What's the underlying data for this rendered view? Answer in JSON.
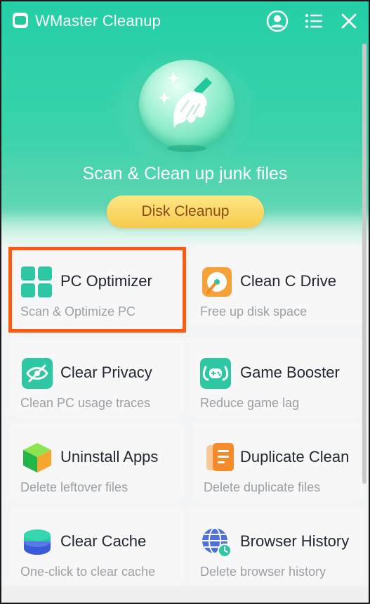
{
  "app": {
    "title": "WMaster Cleanup"
  },
  "titlebar": {
    "icons": [
      "user-icon",
      "menu-icon",
      "close-icon"
    ]
  },
  "hero": {
    "subtitle": "Scan & Clean up junk files",
    "cta_label": "Disk Cleanup",
    "illustration": "broom-icon"
  },
  "features": [
    {
      "title": "PC Optimizer",
      "subtitle": "Scan & Optimize PC",
      "icon": "windows-grid-icon",
      "highlighted": true
    },
    {
      "title": "Clean C Drive",
      "subtitle": "Free up disk space",
      "icon": "disk-icon"
    },
    {
      "title": "Clear Privacy",
      "subtitle": "Clean PC usage traces",
      "icon": "privacy-eye-icon"
    },
    {
      "title": "Game Booster",
      "subtitle": "Reduce game lag",
      "icon": "gamepad-icon"
    },
    {
      "title": "Uninstall Apps",
      "subtitle": "Delete leftover files",
      "icon": "package-cube-icon"
    },
    {
      "title": "Duplicate Clean",
      "subtitle": "Delete duplicate files",
      "icon": "documents-icon"
    },
    {
      "title": "Clear Cache",
      "subtitle": "One-click to clear cache",
      "icon": "database-icon"
    },
    {
      "title": "Browser History",
      "subtitle": "Delete browser history",
      "icon": "globe-clock-icon"
    }
  ],
  "colors": {
    "brand": "#24cfa6",
    "cta": "#f7cb4b",
    "highlight": "#fb5b12"
  }
}
